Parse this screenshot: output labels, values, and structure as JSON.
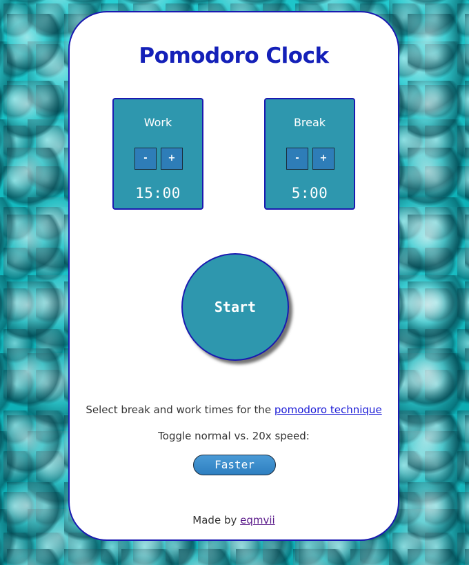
{
  "app": {
    "title": "Pomodoro Clock"
  },
  "work": {
    "label": "Work",
    "minus_label": "-",
    "plus_label": "+",
    "time": "15:00"
  },
  "break": {
    "label": "Break",
    "minus_label": "-",
    "plus_label": "+",
    "time": "5:00"
  },
  "start": {
    "label": "Start"
  },
  "info": {
    "select_text": "Select break and work times for the ",
    "technique_link": "pomodoro technique",
    "toggle_text": "Toggle normal vs. 20x speed:",
    "speed_button": "Faster"
  },
  "footer": {
    "made_by": "Made by ",
    "author_link": "eqmvii"
  },
  "colors": {
    "background": "#14b9bf",
    "accent": "#1a1ab0",
    "panel": "#2e97ae",
    "title": "#1420b8",
    "button": "#2e7db8"
  }
}
